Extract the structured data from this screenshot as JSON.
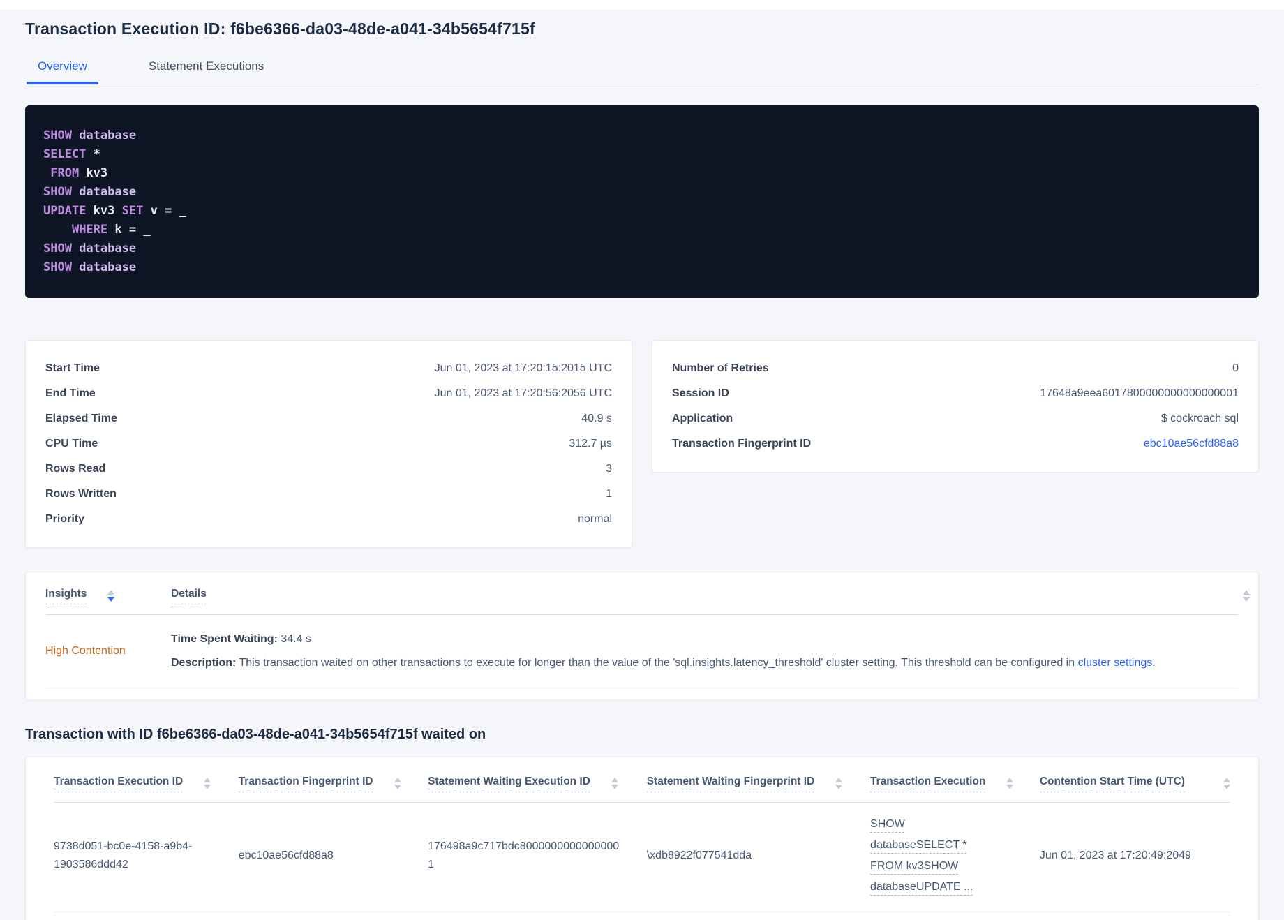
{
  "colors": {
    "accent": "#2962ff",
    "insight_orange": "#bf6318",
    "code_bg": "#0e1626",
    "code_keyword": "#bd8be0",
    "code_identifier": "#cfb8ef",
    "code_plain": "#eceaf4"
  },
  "header": {
    "title": "Transaction Execution ID: f6be6366-da03-48de-a041-34b5654f715f",
    "tabs": [
      {
        "label": "Overview",
        "active": true
      },
      {
        "label": "Statement Executions",
        "active": false
      }
    ]
  },
  "sql_box": {
    "lines": [
      [
        [
          "kw",
          "SHOW"
        ],
        [
          "id",
          " database"
        ]
      ],
      [
        [
          "kw",
          "SELECT"
        ],
        [
          "pl",
          " *"
        ]
      ],
      [
        [
          "pl",
          " "
        ],
        [
          "kw",
          "FROM"
        ],
        [
          "pl",
          " kv3"
        ]
      ],
      [
        [
          "kw",
          "SHOW"
        ],
        [
          "id",
          " database"
        ]
      ],
      [
        [
          "kw",
          "UPDATE"
        ],
        [
          "pl",
          " kv3 "
        ],
        [
          "kw",
          "SET"
        ],
        [
          "pl",
          " v = _"
        ]
      ],
      [
        [
          "pl",
          "    "
        ],
        [
          "kw",
          "WHERE"
        ],
        [
          "pl",
          " k = _"
        ]
      ],
      [
        [
          "kw",
          "SHOW"
        ],
        [
          "id",
          " database"
        ]
      ],
      [
        [
          "kw",
          "SHOW"
        ],
        [
          "id",
          " database"
        ]
      ]
    ]
  },
  "summary_cards": {
    "left": [
      {
        "label": "Start Time",
        "value": "Jun 01, 2023 at 17:20:15:2015 UTC"
      },
      {
        "label": "End Time",
        "value": "Jun 01, 2023 at 17:20:56:2056 UTC"
      },
      {
        "label": "Elapsed Time",
        "value": "40.9 s"
      },
      {
        "label": "CPU Time",
        "value": "312.7 µs"
      },
      {
        "label": "Rows Read",
        "value": "3"
      },
      {
        "label": "Rows Written",
        "value": "1"
      },
      {
        "label": "Priority",
        "value": "normal"
      }
    ],
    "right": [
      {
        "label": "Number of Retries",
        "value": "0"
      },
      {
        "label": "Session ID",
        "value": "17648a9eea6017800000000000000001"
      },
      {
        "label": "Application",
        "value": "$ cockroach sql"
      },
      {
        "label": "Transaction Fingerprint ID",
        "value": "ebc10ae56cfd88a8",
        "link": true
      }
    ]
  },
  "insights": {
    "col_insights": "Insights",
    "col_details": "Details",
    "row": {
      "insight": "High Contention",
      "time_label": "Time Spent Waiting:",
      "time_value": " 34.4 s",
      "desc_label": "Description:",
      "desc_text": " This transaction waited on other transactions to execute for longer than the value of the 'sql.insights.latency_threshold' cluster setting. This threshold can be configured in ",
      "desc_link": "cluster settings",
      "desc_end": "."
    }
  },
  "waited_on": {
    "heading": "Transaction with ID f6be6366-da03-48de-a041-34b5654f715f waited on",
    "columns": [
      "Transaction Execution ID",
      "Transaction Fingerprint ID",
      "Statement Waiting Execution ID",
      "Statement Waiting Fingerprint ID",
      "Transaction Execution",
      "Contention Start Time (UTC)"
    ],
    "row": [
      {
        "value": "9738d051-bc0e-4158-a9b4-1903586ddd42"
      },
      {
        "value": "ebc10ae56cfd88a8"
      },
      {
        "value": "176498a9c717bdc80000000000000001"
      },
      {
        "value": "\\xdb8922f077541dda"
      },
      {
        "value": "SHOW databaseSELECT * FROM kv3SHOW databaseUPDATE ...",
        "dashed": true
      },
      {
        "value": "Jun 01, 2023 at 17:20:49:2049"
      }
    ]
  }
}
